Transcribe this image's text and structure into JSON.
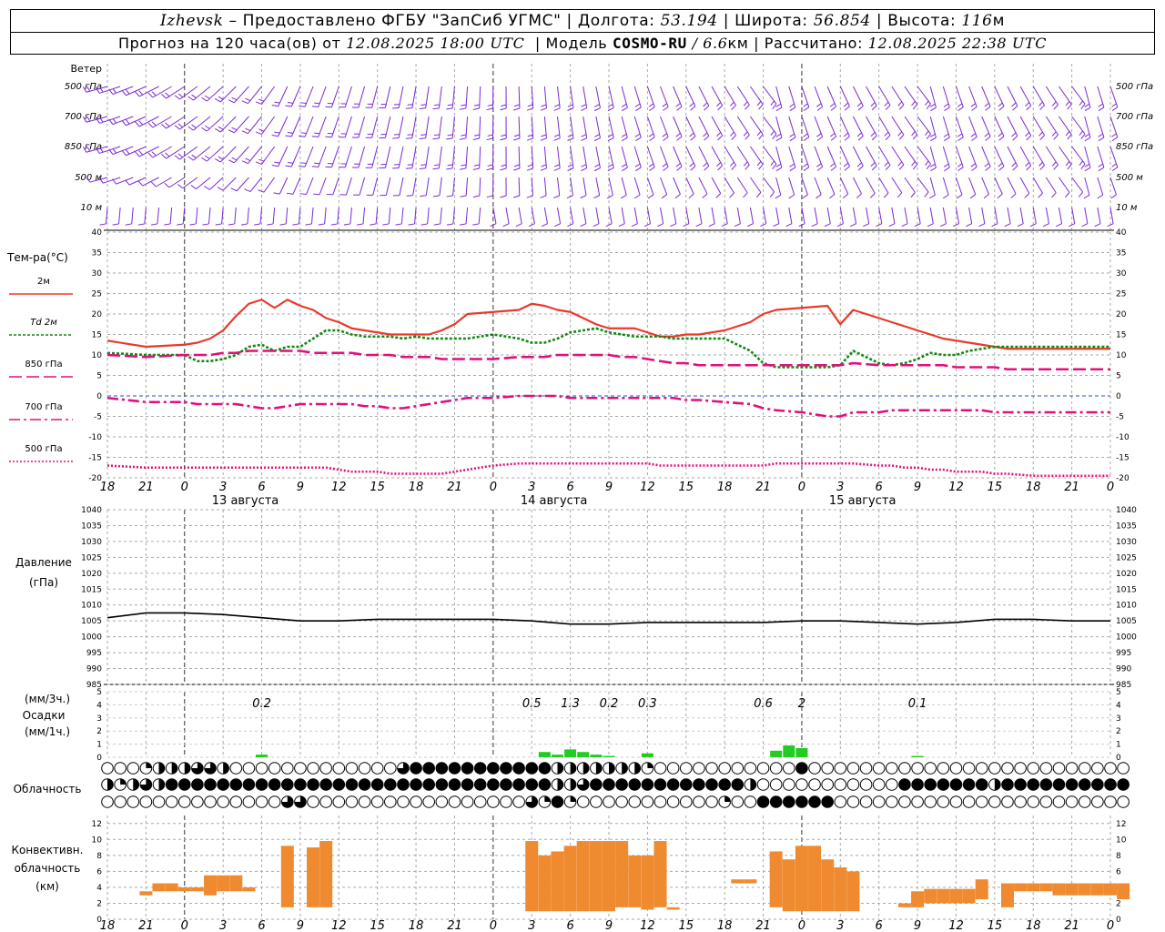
{
  "header": {
    "city": "Izhevsk",
    "provider": "– Предоставлено ФГБУ \"ЗапСиб УГМС\"",
    "lon_label": "Долгота:",
    "lon": "53.194",
    "lat_label": "Широта:",
    "lat": "56.854",
    "alt_label": "Высота:",
    "alt": "116",
    "alt_unit": "м",
    "fc_label": "Прогноз на 120 часа(ов) от",
    "fc_time": "12.08.2025 18:00 UTC",
    "model_label": "Модель",
    "model": "COSMO-RU",
    "res": "/ 6.6",
    "res_unit": "км",
    "calc_label": "Рассчитано:",
    "calc_time": "12.08.2025 22:38 UTC"
  },
  "colors": {
    "wind": "#7b2ad6",
    "t2m": "#e83a2a",
    "td2m": "#118a11",
    "t850": "#e0107a",
    "t700": "#e0107a",
    "t500": "#e0107a",
    "precip": "#22cc22",
    "convective": "#f08a30",
    "pressure": "#000000"
  },
  "time_axis": {
    "tick_labels": [
      "18",
      "21",
      "0",
      "3",
      "6",
      "9",
      "12",
      "15",
      "18",
      "21",
      "0",
      "3",
      "6",
      "9",
      "12",
      "15",
      "18",
      "21",
      "0",
      "3",
      "6",
      "9",
      "12",
      "15",
      "18",
      "21",
      "0"
    ],
    "day_labels": [
      "13 августа",
      "14 августа",
      "15 августа"
    ]
  },
  "wind_panel": {
    "title": "Ветер",
    "levels": [
      "500 гПа",
      "700 гПа",
      "850 гПа",
      "500  м",
      "10   м"
    ]
  },
  "temp_panel": {
    "title": "Тем-ра(°C)",
    "legend": [
      {
        "name": "2м",
        "style": "solid",
        "color_key": "t2m"
      },
      {
        "name": "Td  2м",
        "style": "dotted",
        "color_key": "td2m"
      },
      {
        "name": "850 гПа",
        "style": "dashed",
        "color_key": "t850"
      },
      {
        "name": "700 гПа",
        "style": "dashdot",
        "color_key": "t700"
      },
      {
        "name": "500 гПа",
        "style": "fine",
        "color_key": "t500"
      }
    ],
    "yticks": [
      "40",
      "35",
      "30",
      "25",
      "20",
      "15",
      "10",
      "5",
      "0",
      "-5",
      "-10",
      "-15",
      "-20"
    ]
  },
  "pressure_panel": {
    "title1": "Давление",
    "title2": "(гПа)",
    "yticks": [
      "1040",
      "1035",
      "1030",
      "1025",
      "1020",
      "1015",
      "1010",
      "1005",
      "1000",
      "995",
      "990",
      "985"
    ]
  },
  "precip_panel": {
    "title1": "(мм/3ч.)",
    "title2": "Осадки",
    "title3": "(мм/1ч.)",
    "yticks": [
      "5",
      "4",
      "3",
      "2",
      "1",
      "0"
    ],
    "totals": [
      {
        "hour": 12,
        "label": "0.2"
      },
      {
        "hour": 33,
        "label": "0.5"
      },
      {
        "hour": 36,
        "label": "1.3"
      },
      {
        "hour": 39,
        "label": "0.2"
      },
      {
        "hour": 42,
        "label": "0.3"
      },
      {
        "hour": 51,
        "label": "0.6"
      },
      {
        "hour": 54,
        "label": "2"
      },
      {
        "hour": 63,
        "label": "0.1"
      }
    ]
  },
  "cloud_panel": {
    "title": "Облачность"
  },
  "conv_panel": {
    "title1": "Конвективн.",
    "title2": "облачность",
    "title3": "(км)",
    "yticks": [
      "12",
      "10",
      "8",
      "6",
      "4",
      "2",
      "0"
    ]
  },
  "chart_data": [
    {
      "type": "line",
      "title": "Тем-ра(°C)",
      "x_hours_from_start": [
        0,
        3,
        6,
        7,
        8,
        9,
        10,
        11,
        12,
        13,
        14,
        15,
        16,
        17,
        18,
        19,
        20,
        21,
        22,
        23,
        24,
        25,
        26,
        27,
        28,
        30,
        32,
        33,
        34,
        35,
        36,
        37,
        38,
        39,
        40,
        41,
        42,
        43,
        44,
        45,
        46,
        48,
        50,
        51,
        52,
        54,
        56,
        57,
        58,
        60,
        61,
        62,
        63,
        64,
        65,
        66,
        67,
        68,
        69,
        70,
        72,
        74,
        76,
        78
      ],
      "ylim": [
        -20,
        40
      ],
      "series": [
        {
          "name": "2м",
          "values": [
            13.5,
            12,
            12.5,
            13,
            14,
            16,
            19.5,
            22.5,
            23.5,
            21.5,
            23.5,
            22,
            21,
            19,
            18,
            16.5,
            16,
            15.5,
            15,
            15,
            15,
            15,
            16,
            17.5,
            20,
            20.5,
            21,
            22.5,
            22,
            21,
            20.5,
            19,
            17.5,
            16.5,
            16.5,
            16.5,
            15.5,
            14.5,
            14.5,
            15,
            15,
            16,
            18,
            20,
            21,
            21.5,
            22,
            17.5,
            21,
            19,
            18,
            17,
            16,
            15,
            14,
            13.5,
            13,
            12.5,
            12,
            11.5,
            11.5,
            11.5,
            11.5,
            11.5
          ]
        },
        {
          "name": "Td  2м",
          "values": [
            10.5,
            10,
            10,
            8.5,
            8.5,
            9,
            10,
            12,
            12.5,
            11,
            12,
            12,
            14,
            16,
            16,
            15,
            14.5,
            14.5,
            14.5,
            14,
            14.5,
            14,
            14,
            14,
            14,
            15,
            14,
            13,
            13,
            14,
            15.5,
            16,
            16.5,
            15.5,
            15,
            14.5,
            14.5,
            14.5,
            14,
            14,
            14,
            14,
            11,
            8,
            7,
            7,
            7,
            7.5,
            11,
            8,
            7.5,
            8,
            9,
            10.5,
            10,
            10,
            11,
            11.5,
            12,
            12,
            12,
            12,
            12,
            12
          ]
        },
        {
          "name": "850 гПа",
          "values": [
            10,
            9.5,
            10,
            10,
            10,
            10.5,
            10.5,
            11,
            11,
            11,
            11,
            11,
            10.5,
            10.5,
            10.5,
            10.5,
            10,
            10,
            10,
            9.5,
            9.5,
            9.5,
            9,
            9,
            9,
            9,
            9.5,
            9.5,
            9.5,
            10,
            10,
            10,
            10,
            10,
            9.5,
            9.5,
            9,
            8.5,
            8,
            8,
            7.5,
            7.5,
            7.5,
            7.5,
            7.5,
            7.5,
            7.5,
            7.5,
            8,
            7.5,
            7.5,
            7.5,
            7.5,
            7.5,
            7.5,
            7,
            7,
            7,
            7,
            6.5,
            6.5,
            6.5,
            6.5,
            6.5
          ]
        },
        {
          "name": "700 гПа",
          "values": [
            -0.5,
            -1.5,
            -1.5,
            -2,
            -2,
            -2,
            -2,
            -2.5,
            -3,
            -3,
            -2.5,
            -2,
            -2,
            -2,
            -2,
            -2,
            -2.5,
            -2.5,
            -3,
            -3,
            -2.5,
            -2,
            -1.5,
            -1,
            -0.5,
            -0.5,
            0,
            0,
            0,
            0,
            -0.5,
            -0.5,
            -0.5,
            -0.5,
            -0.5,
            -0.5,
            -0.5,
            -0.5,
            -0.5,
            -1,
            -1,
            -1.5,
            -2,
            -3,
            -3.5,
            -4,
            -5,
            -5,
            -4,
            -4,
            -3.5,
            -3.5,
            -3.5,
            -3.5,
            -3.5,
            -3.5,
            -3.5,
            -3.5,
            -4,
            -4,
            -4,
            -4,
            -4,
            -4
          ]
        },
        {
          "name": "500 гПа",
          "values": [
            -17,
            -17.5,
            -17.5,
            -17.5,
            -17.5,
            -17.5,
            -17.5,
            -17.5,
            -17.5,
            -17.5,
            -17.5,
            -17.5,
            -17.5,
            -17.5,
            -18,
            -18.5,
            -18.5,
            -18.5,
            -19,
            -19,
            -19,
            -19,
            -19,
            -18.5,
            -18,
            -17,
            -16.5,
            -16.5,
            -16.5,
            -16.5,
            -16.5,
            -16.5,
            -16.5,
            -16.5,
            -16.5,
            -16.5,
            -16.5,
            -17,
            -17,
            -17,
            -17,
            -17,
            -17,
            -17,
            -16.5,
            -16.5,
            -16.5,
            -16.5,
            -16.5,
            -17,
            -17,
            -17.5,
            -17.5,
            -18,
            -18,
            -18.5,
            -18.5,
            -18.5,
            -19,
            -19,
            -19.5,
            -19.5,
            -19.5,
            -19.5
          ]
        }
      ]
    },
    {
      "type": "line",
      "title": "Давление (гПа)",
      "ylim": [
        985,
        1040
      ],
      "x_hours_from_start": [
        0,
        3,
        6,
        9,
        12,
        15,
        18,
        21,
        24,
        27,
        30,
        33,
        36,
        39,
        42,
        45,
        48,
        51,
        54,
        57,
        60,
        63,
        66,
        69,
        72,
        75,
        78
      ],
      "series": [
        {
          "values": [
            1006,
            1007.5,
            1007.5,
            1007,
            1006,
            1005,
            1005,
            1005.5,
            1005.5,
            1005.5,
            1005.5,
            1005,
            1004,
            1004,
            1004.5,
            1004.5,
            1004.5,
            1004.5,
            1005,
            1005,
            1004.5,
            1004,
            1004.5,
            1005.5,
            1005.5,
            1005,
            1005
          ]
        }
      ]
    },
    {
      "type": "bar",
      "title": "Осадки (мм/1ч.)",
      "ylim": [
        0,
        5
      ],
      "x_hours_from_start": [
        12,
        34,
        35,
        36,
        37,
        38,
        39,
        40,
        41,
        42,
        43,
        44,
        45,
        46,
        47,
        48,
        49,
        50,
        51,
        52,
        53,
        54,
        55,
        56,
        57,
        58,
        59,
        60,
        61,
        62,
        63
      ],
      "values": [
        0.2,
        0.4,
        0.2,
        0.6,
        0.4,
        0.2,
        0.1,
        0,
        0,
        0.3,
        0,
        0,
        0,
        0,
        0,
        0,
        0,
        0,
        0,
        0.5,
        0.9,
        0.7,
        0,
        0,
        0,
        0,
        0,
        0,
        0,
        0,
        0.1
      ]
    },
    {
      "type": "bar",
      "title": "Конвективн. облачность (км)",
      "ylim": [
        0,
        13
      ],
      "bars_bottom_top_km": [
        {
          "h": 3,
          "b": 3,
          "t": 3.5
        },
        {
          "h": 4,
          "b": 3.5,
          "t": 4.5
        },
        {
          "h": 5,
          "b": 3.5,
          "t": 4.5
        },
        {
          "h": 6,
          "b": 3.5,
          "t": 4
        },
        {
          "h": 7,
          "b": 3.5,
          "t": 4
        },
        {
          "h": 8,
          "b": 3,
          "t": 5.5
        },
        {
          "h": 9,
          "b": 3.5,
          "t": 5.5
        },
        {
          "h": 10,
          "b": 3.5,
          "t": 5.5
        },
        {
          "h": 11,
          "b": 3.5,
          "t": 4
        },
        {
          "h": 14,
          "b": 1.5,
          "t": 9.2
        },
        {
          "h": 16,
          "b": 1.5,
          "t": 9
        },
        {
          "h": 17,
          "b": 1.5,
          "t": 9.8
        },
        {
          "h": 33,
          "b": 1,
          "t": 9.8
        },
        {
          "h": 34,
          "b": 1,
          "t": 8
        },
        {
          "h": 35,
          "b": 1,
          "t": 8.5
        },
        {
          "h": 36,
          "b": 1,
          "t": 9.2
        },
        {
          "h": 37,
          "b": 1,
          "t": 9.8
        },
        {
          "h": 38,
          "b": 1,
          "t": 9.8
        },
        {
          "h": 39,
          "b": 1,
          "t": 9.8
        },
        {
          "h": 40,
          "b": 1.5,
          "t": 9.8
        },
        {
          "h": 41,
          "b": 1.5,
          "t": 8
        },
        {
          "h": 42,
          "b": 1.2,
          "t": 8
        },
        {
          "h": 43,
          "b": 1.5,
          "t": 9.8
        },
        {
          "h": 44,
          "b": 1.2,
          "t": 1.5
        },
        {
          "h": 49,
          "b": 4.5,
          "t": 5
        },
        {
          "h": 50,
          "b": 4.5,
          "t": 5
        },
        {
          "h": 52,
          "b": 1.5,
          "t": 8.5
        },
        {
          "h": 53,
          "b": 1,
          "t": 7.5
        },
        {
          "h": 54,
          "b": 1,
          "t": 9.2
        },
        {
          "h": 55,
          "b": 1,
          "t": 9.2
        },
        {
          "h": 56,
          "b": 1,
          "t": 7.5
        },
        {
          "h": 57,
          "b": 1,
          "t": 6.5
        },
        {
          "h": 58,
          "b": 1,
          "t": 6
        },
        {
          "h": 62,
          "b": 1.5,
          "t": 2
        },
        {
          "h": 63,
          "b": 1.5,
          "t": 3.5
        },
        {
          "h": 64,
          "b": 2,
          "t": 3.8
        },
        {
          "h": 65,
          "b": 2,
          "t": 3.8
        },
        {
          "h": 66,
          "b": 2,
          "t": 3.8
        },
        {
          "h": 67,
          "b": 2,
          "t": 3.8
        },
        {
          "h": 68,
          "b": 2.5,
          "t": 5
        },
        {
          "h": 70,
          "b": 1.5,
          "t": 4.5
        },
        {
          "h": 71,
          "b": 3.5,
          "t": 4.5
        },
        {
          "h": 72,
          "b": 3.5,
          "t": 4.5
        },
        {
          "h": 73,
          "b": 3.5,
          "t": 4.5
        },
        {
          "h": 74,
          "b": 3,
          "t": 4.5
        },
        {
          "h": 75,
          "b": 3,
          "t": 4.5
        },
        {
          "h": 76,
          "b": 3,
          "t": 4.5
        },
        {
          "h": 77,
          "b": 3,
          "t": 4.5
        },
        {
          "h": 78,
          "b": 3,
          "t": 4.5
        },
        {
          "h": 79,
          "b": 2.5,
          "t": 4.5
        }
      ]
    },
    {
      "type": "table",
      "title": "Облачность",
      "rows_eighths_coverage_per_hour": [
        [
          0,
          0,
          0,
          2,
          4,
          4,
          4,
          6,
          6,
          4,
          0,
          0,
          0,
          0,
          0,
          0,
          0,
          0,
          0,
          0,
          0,
          0,
          0,
          6,
          8,
          8,
          8,
          8,
          8,
          8,
          8,
          8,
          8,
          8,
          8,
          4,
          4,
          4,
          4,
          4,
          4,
          4,
          2,
          0,
          0,
          0,
          0,
          0,
          0,
          0,
          0,
          0,
          0,
          0,
          8,
          0,
          0,
          0,
          0,
          0,
          0,
          0,
          0,
          0,
          0,
          0,
          0,
          0,
          0,
          0,
          0,
          0,
          0,
          0,
          0,
          0,
          0,
          0,
          0,
          0
        ],
        [
          4,
          2,
          4,
          6,
          4,
          8,
          8,
          8,
          8,
          8,
          8,
          8,
          8,
          8,
          8,
          8,
          8,
          8,
          8,
          8,
          8,
          8,
          8,
          8,
          8,
          8,
          8,
          8,
          8,
          8,
          8,
          8,
          8,
          8,
          8,
          4,
          4,
          6,
          8,
          8,
          8,
          8,
          8,
          8,
          8,
          8,
          8,
          8,
          8,
          8,
          4,
          0,
          0,
          0,
          0,
          0,
          0,
          0,
          0,
          0,
          0,
          0,
          8,
          8,
          8,
          8,
          8,
          8,
          8,
          4,
          8,
          8,
          8,
          8,
          8,
          8,
          8,
          8,
          8,
          8
        ],
        [
          0,
          0,
          0,
          0,
          0,
          0,
          0,
          0,
          0,
          0,
          0,
          0,
          0,
          0,
          6,
          6,
          0,
          0,
          0,
          0,
          0,
          0,
          0,
          0,
          0,
          0,
          0,
          0,
          0,
          0,
          0,
          0,
          0,
          6,
          2,
          8,
          2,
          0,
          0,
          0,
          0,
          0,
          0,
          0,
          0,
          0,
          0,
          0,
          2,
          0,
          0,
          8,
          8,
          8,
          8,
          8,
          8,
          0,
          0,
          0,
          0,
          0,
          0,
          0,
          0,
          0,
          0,
          0,
          0,
          0,
          0,
          0,
          0,
          0,
          0,
          0,
          0,
          0,
          0,
          0
        ]
      ]
    }
  ]
}
